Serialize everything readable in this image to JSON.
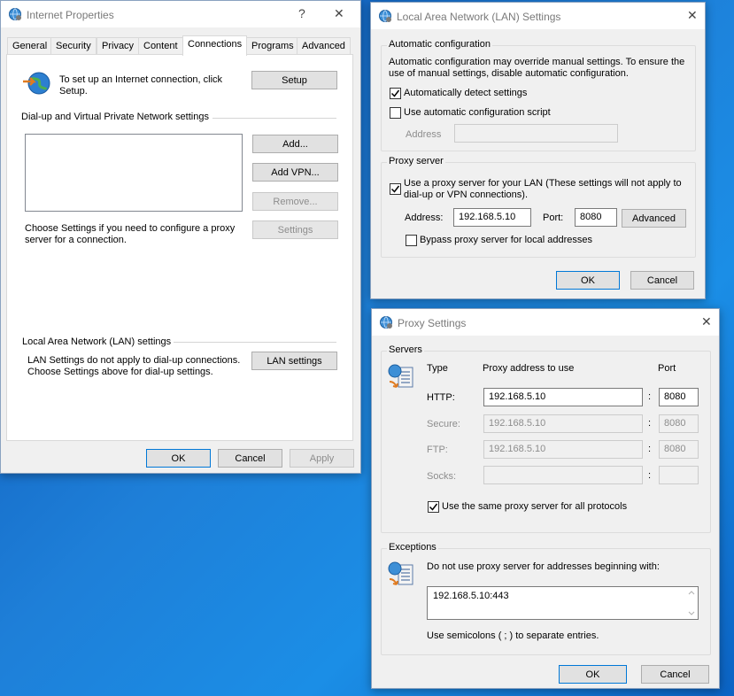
{
  "colors": {
    "desktop": "#1e7fd8",
    "dialog_bg": "#f0f0f0",
    "focus_border": "#0078d7"
  },
  "internet_properties": {
    "title": "Internet Properties",
    "help_glyph": "?",
    "close_glyph": "✕",
    "tabs": [
      "General",
      "Security",
      "Privacy",
      "Content",
      "Connections",
      "Programs",
      "Advanced"
    ],
    "setup_text_line1": "To set up an Internet connection, click",
    "setup_text_line2": "Setup.",
    "setup_button": "Setup",
    "vpn_section": "Dial-up and Virtual Private Network settings",
    "add_button": "Add...",
    "add_vpn_button": "Add VPN...",
    "remove_button": "Remove...",
    "settings_button": "Settings",
    "proxy_hint_line1": "Choose Settings if you need to configure a proxy",
    "proxy_hint_line2": "server for a connection.",
    "lan_section": "Local Area Network (LAN) settings",
    "lan_hint_line1": "LAN Settings do not apply to dial-up connections.",
    "lan_hint_line2": "Choose Settings above for dial-up settings.",
    "lan_settings_button": "LAN settings",
    "ok": "OK",
    "cancel": "Cancel",
    "apply": "Apply"
  },
  "lan_settings": {
    "title": "Local Area Network (LAN) Settings",
    "close_glyph": "✕",
    "auto_group": "Automatic configuration",
    "auto_desc_line1": "Automatic configuration may override manual settings.  To ensure the",
    "auto_desc_line2": "use of manual settings, disable automatic configuration.",
    "auto_detect_label": "Automatically detect settings",
    "auto_detect_checked": true,
    "auto_script_label": "Use automatic configuration script",
    "auto_script_checked": false,
    "address_label": "Address",
    "address_value": "",
    "proxy_group": "Proxy server",
    "use_proxy_line1": "Use a proxy server for your LAN (These settings will not apply to",
    "use_proxy_line2": "dial-up or VPN connections).",
    "use_proxy_checked": true,
    "proxy_address_label": "Address:",
    "proxy_address_value": "192.168.5.10",
    "port_label": "Port:",
    "port_value": "8080",
    "advanced_button": "Advanced",
    "bypass_label": "Bypass proxy server for local addresses",
    "bypass_checked": false,
    "ok": "OK",
    "cancel": "Cancel"
  },
  "proxy_settings": {
    "title": "Proxy Settings",
    "close_glyph": "✕",
    "servers_group": "Servers",
    "col_type": "Type",
    "col_address": "Proxy address to use",
    "col_port": "Port",
    "colon": ":",
    "rows": [
      {
        "type": "HTTP:",
        "address": "192.168.5.10",
        "port": "8080",
        "enabled": true
      },
      {
        "type": "Secure:",
        "address": "192.168.5.10",
        "port": "8080",
        "enabled": false
      },
      {
        "type": "FTP:",
        "address": "192.168.5.10",
        "port": "8080",
        "enabled": false
      },
      {
        "type": "Socks:",
        "address": "",
        "port": "",
        "enabled": false
      }
    ],
    "same_proxy_label": "Use the same proxy server for all protocols",
    "same_proxy_checked": true,
    "exceptions_group": "Exceptions",
    "exceptions_desc": "Do not use proxy server for addresses beginning with:",
    "exceptions_value": "192.168.5.10:443",
    "semicolon_hint": "Use semicolons ( ; ) to separate entries.",
    "ok": "OK",
    "cancel": "Cancel"
  }
}
